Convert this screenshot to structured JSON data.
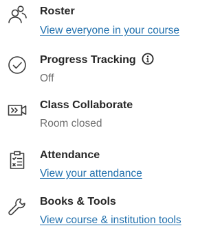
{
  "items": [
    {
      "id": "roster",
      "icon": "users-icon",
      "title": "Roster",
      "subtitle": "View everyone in your course",
      "subtitle_is_link": true
    },
    {
      "id": "progress",
      "icon": "check-circle-icon",
      "title": "Progress Tracking",
      "subtitle": "Off",
      "subtitle_is_link": false,
      "has_info_icon": true
    },
    {
      "id": "collab",
      "icon": "video-camera-icon",
      "title": "Class Collaborate",
      "subtitle": "Room closed",
      "subtitle_is_link": false
    },
    {
      "id": "attendance",
      "icon": "clipboard-icon",
      "title": "Attendance",
      "subtitle": "View your attendance",
      "subtitle_is_link": true
    },
    {
      "id": "books",
      "icon": "wrench-icon",
      "title": "Books & Tools",
      "subtitle": "View course & institution tools",
      "subtitle_is_link": true
    }
  ],
  "colors": {
    "text": "#262626",
    "link": "#1f6fad",
    "muted": "#6e6e6e",
    "icon": "#3b3b3b"
  }
}
